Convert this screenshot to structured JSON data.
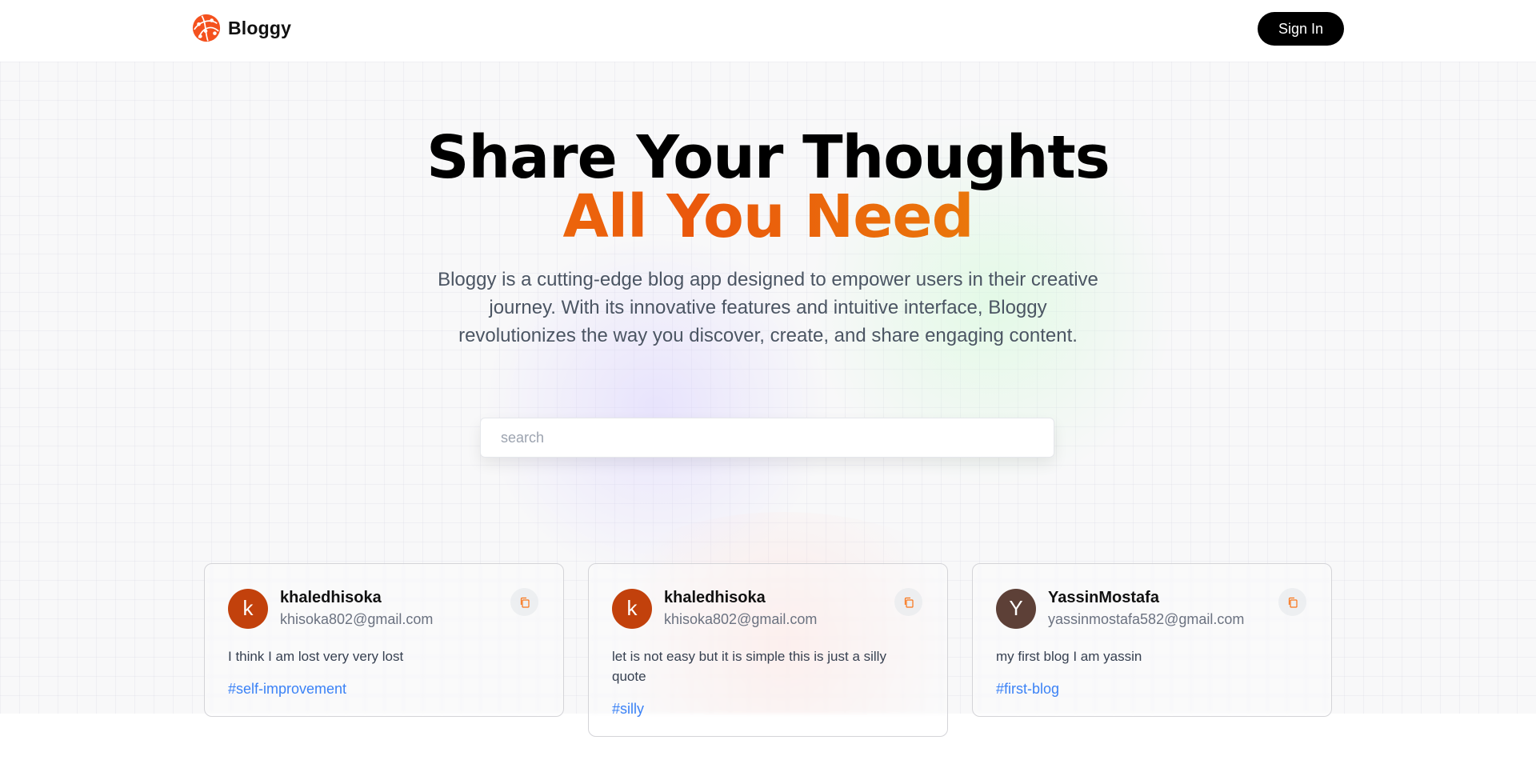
{
  "header": {
    "brand": "Bloggy",
    "sign_in_label": "Sign In"
  },
  "hero": {
    "title": "Share Your Thoughts",
    "subtitle": "All You Need",
    "description": "Bloggy is a cutting-edge blog app designed to empower users in their creative journey. With its innovative features and intuitive interface, Bloggy revolutionizes the way you discover, create, and share engaging content."
  },
  "search": {
    "placeholder": "search",
    "value": ""
  },
  "posts": [
    {
      "avatar_letter": "k",
      "avatar_color": "#c2410c",
      "username": "khaledhisoka",
      "email": "khisoka802@gmail.com",
      "text": "I think I am lost very very lost",
      "tag": "#self-improvement"
    },
    {
      "avatar_letter": "k",
      "avatar_color": "#c2410c",
      "username": "khaledhisoka",
      "email": "khisoka802@gmail.com",
      "text": "let is not easy but it is simple this is just a silly quote",
      "tag": "#silly"
    },
    {
      "avatar_letter": "Y",
      "avatar_color": "#5d4037",
      "username": "YassinMostafa",
      "email": "yassinmostafa582@gmail.com",
      "text": "my first blog I am yassin",
      "tag": "#first-blog"
    }
  ],
  "colors": {
    "accent_orange": "#ea580c",
    "tag_blue": "#3b82f6",
    "sign_in_bg": "#000000"
  },
  "icons": {
    "logo": "globe-logo-icon",
    "copy": "copy-icon"
  }
}
